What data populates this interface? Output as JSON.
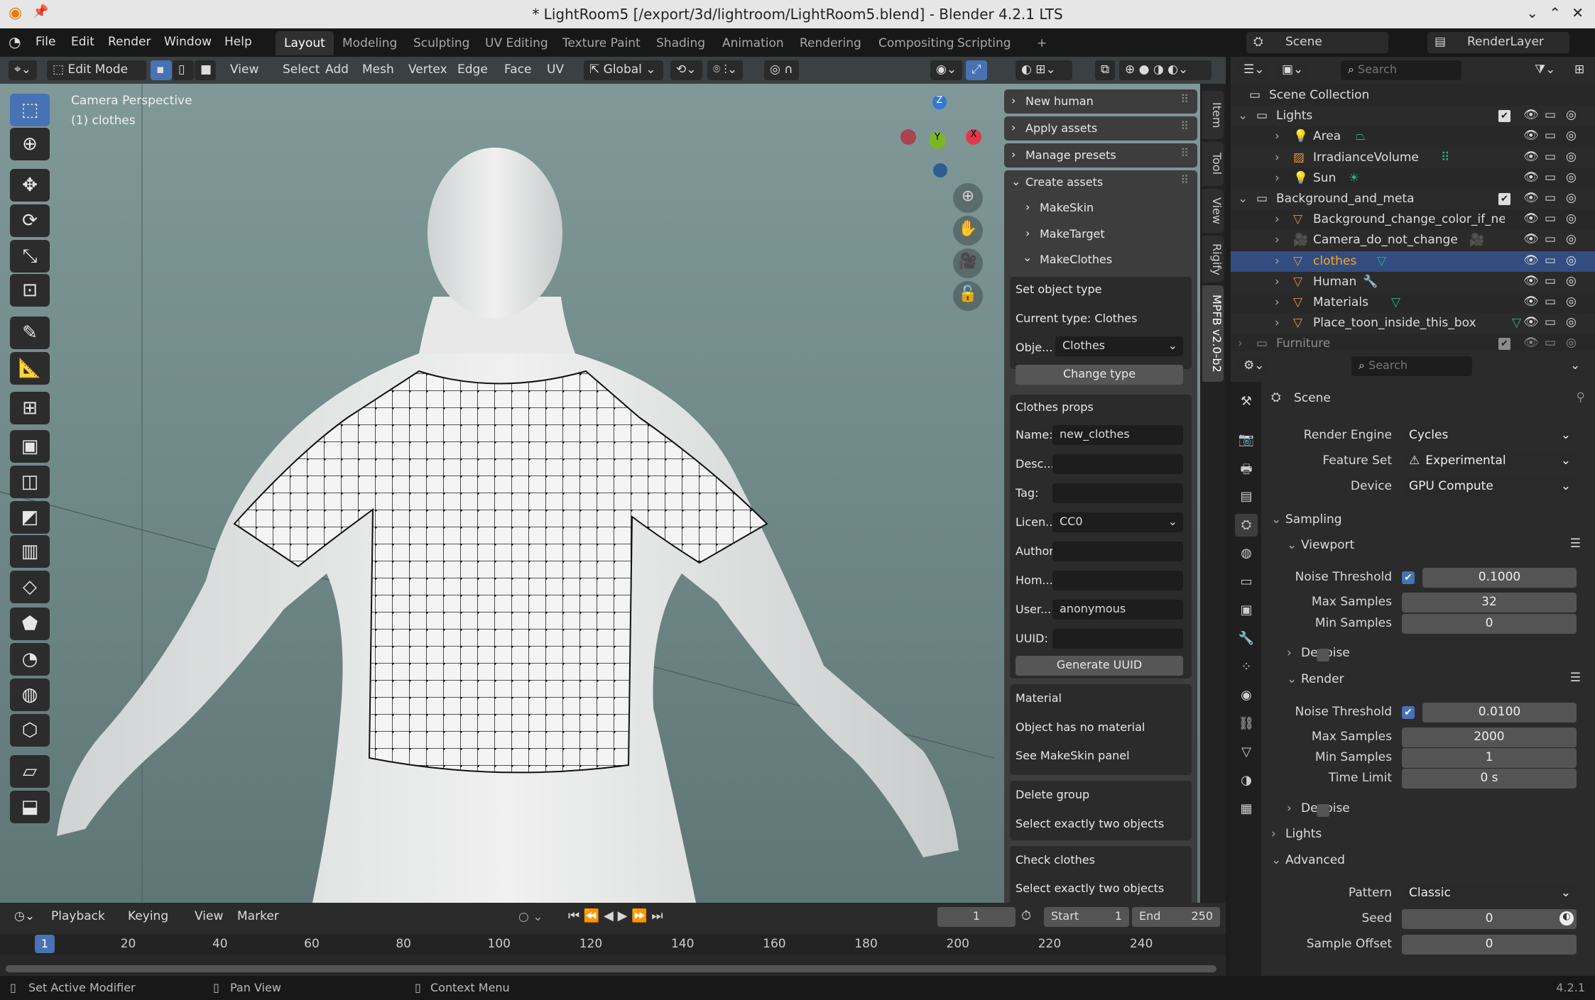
{
  "window": {
    "title": "* LightRoom5 [/export/3d/lightroom/LightRoom5.blend] - Blender 4.2.1 LTS"
  },
  "menu": {
    "items": [
      "File",
      "Edit",
      "Render",
      "Window",
      "Help"
    ]
  },
  "workspaces": [
    "Layout",
    "Modeling",
    "Sculpting",
    "UV Editing",
    "Texture Paint",
    "Shading",
    "Animation",
    "Rendering",
    "Compositing",
    "Scripting",
    "+"
  ],
  "active_workspace": "Layout",
  "scene_selector": {
    "scene": "Scene",
    "view_layer": "RenderLayer"
  },
  "viewport_header": {
    "mode": "Edit Mode",
    "menus": [
      "View",
      "Select",
      "Add",
      "Mesh",
      "Vertex",
      "Edge",
      "Face",
      "UV"
    ],
    "transform_orientation": "Global"
  },
  "viewport": {
    "overlay_line1": "Camera Perspective",
    "overlay_line2": "(1) clothes",
    "gizmo": {
      "x": "X",
      "y": "Y",
      "z": "Z"
    }
  },
  "toolbar": {
    "tools": [
      "select-box",
      "cursor",
      "move",
      "rotate",
      "scale",
      "transform",
      "annotate",
      "measure",
      "add-cube",
      "extrude",
      "inset",
      "bevel",
      "loop-cut",
      "knife",
      "poly-build",
      "spin",
      "smooth",
      "shrink-fatten",
      "shear",
      "rip"
    ],
    "active": "select-box"
  },
  "npanel": {
    "tabs": [
      "Item",
      "Tool",
      "View",
      "Rigify",
      "MPFB v2.0-b2"
    ],
    "active_tab": "MPFB v2.0-b2",
    "panels": {
      "new_human": "New human",
      "apply_assets": "Apply assets",
      "manage_presets": "Manage presets",
      "create_assets": "Create assets"
    },
    "sub": {
      "makeskin": "MakeSkin",
      "maketarget": "MakeTarget",
      "makeclothes": "MakeClothes"
    },
    "set_object_type": {
      "title": "Set object type",
      "current": "Current type: Clothes",
      "object_label": "Obje...",
      "object_value": "Clothes",
      "button": "Change type"
    },
    "clothes_props": {
      "title": "Clothes props",
      "fields": [
        {
          "label": "Name:",
          "value": "new_clothes"
        },
        {
          "label": "Desc...",
          "value": ""
        },
        {
          "label": "Tag:",
          "value": ""
        },
        {
          "label": "Licen...",
          "value": "CC0",
          "dropdown": true
        },
        {
          "label": "Author:",
          "value": ""
        },
        {
          "label": "Hom...",
          "value": ""
        },
        {
          "label": "User...",
          "value": "anonymous"
        },
        {
          "label": "UUID:",
          "value": ""
        }
      ],
      "button": "Generate UUID"
    },
    "material": {
      "title": "Material",
      "line1": "Object has no material",
      "line2": "See MakeSkin panel"
    },
    "delete_group": {
      "title": "Delete group",
      "line1": "Select exactly two objects"
    },
    "check_clothes": {
      "title": "Check clothes",
      "line1": "Select exactly two objects"
    }
  },
  "timeline": {
    "menus": [
      "Playback",
      "Keying",
      "View",
      "Marker"
    ],
    "current_frame": "1",
    "start_label": "Start",
    "start": "1",
    "end_label": "End",
    "end": "250",
    "ticks": [
      "1",
      "20",
      "40",
      "60",
      "80",
      "100",
      "120",
      "140",
      "160",
      "180",
      "200",
      "220",
      "240"
    ]
  },
  "status": {
    "items": [
      "Set Active Modifier",
      "Pan View",
      "Context Menu"
    ],
    "version": "4.2.1"
  },
  "outliner": {
    "search_placeholder": "Search",
    "rows": [
      {
        "name": "Scene Collection",
        "depth": 0,
        "type": "collection"
      },
      {
        "name": "Lights",
        "depth": 1,
        "type": "collection",
        "expanded": true,
        "checkbox": true
      },
      {
        "name": "Area",
        "depth": 2,
        "type": "light",
        "data": "area-light-icon"
      },
      {
        "name": "IrradianceVolume",
        "depth": 2,
        "type": "lightprobe",
        "data": "grid-icon"
      },
      {
        "name": "Sun",
        "depth": 2,
        "type": "light",
        "data": "sun-icon"
      },
      {
        "name": "Background_and_meta",
        "depth": 1,
        "type": "collection",
        "expanded": true,
        "checkbox": true
      },
      {
        "name": "Background_change_color_if_nec",
        "depth": 2,
        "type": "mesh"
      },
      {
        "name": "Camera_do_not_change",
        "depth": 2,
        "type": "camera",
        "data": "camera-data-icon"
      },
      {
        "name": "clothes",
        "depth": 2,
        "type": "mesh",
        "selected": true,
        "data": "mesh-data-icon"
      },
      {
        "name": "Human",
        "depth": 2,
        "type": "mesh",
        "data": "modifier-icon"
      },
      {
        "name": "Materials",
        "depth": 2,
        "type": "mesh",
        "data": "mesh-data-icon"
      },
      {
        "name": "Place_toon_inside_this_box",
        "depth": 2,
        "type": "mesh",
        "data": "mesh-data-icon"
      },
      {
        "name": "Furniture",
        "depth": 1,
        "type": "collection",
        "checkbox": true,
        "dim": true
      }
    ]
  },
  "properties": {
    "search_placeholder": "Search",
    "context": "Scene",
    "render_engine": {
      "label": "Render Engine",
      "value": "Cycles"
    },
    "feature_set": {
      "label": "Feature Set",
      "value": "Experimental"
    },
    "device": {
      "label": "Device",
      "value": "GPU Compute"
    },
    "sampling": "Sampling",
    "viewport": {
      "title": "Viewport",
      "noise_threshold_label": "Noise Threshold",
      "noise_threshold": "0.1000",
      "max_samples_label": "Max Samples",
      "max_samples": "32",
      "min_samples_label": "Min Samples",
      "min_samples": "0",
      "denoise": "Denoise"
    },
    "render": {
      "title": "Render",
      "noise_threshold_label": "Noise Threshold",
      "noise_threshold": "0.0100",
      "max_samples_label": "Max Samples",
      "max_samples": "2000",
      "min_samples_label": "Min Samples",
      "min_samples": "1",
      "time_limit_label": "Time Limit",
      "time_limit": "0 s",
      "denoise": "Denoise"
    },
    "lights": "Lights",
    "advanced": {
      "title": "Advanced",
      "pattern_label": "Pattern",
      "pattern": "Classic",
      "seed_label": "Seed",
      "seed": "0",
      "sample_offset_label": "Sample Offset",
      "sample_offset": "0"
    }
  },
  "colors": {
    "accent": "#4772b3",
    "selected_row": "#334d80",
    "object_orange": "#e8953c",
    "data_green": "#1fb88a"
  }
}
